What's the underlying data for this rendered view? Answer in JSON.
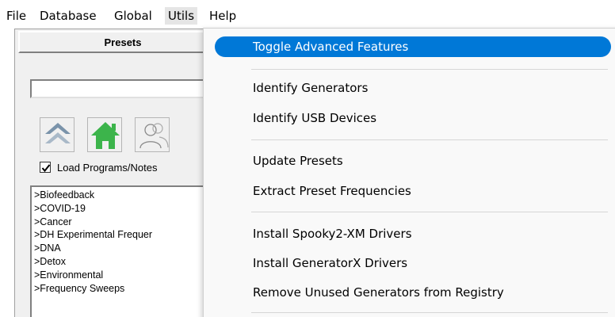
{
  "menubar": {
    "items": [
      {
        "label": "File"
      },
      {
        "label": "Database"
      },
      {
        "label": "Global"
      },
      {
        "label": "Utils",
        "active": true
      },
      {
        "label": "Help"
      }
    ]
  },
  "presets_panel": {
    "title": "Presets",
    "search": {
      "value": "",
      "placeholder": ""
    },
    "toolbar": {
      "buttons": [
        {
          "icon": "double-chevron-up-icon"
        },
        {
          "icon": "home-icon"
        },
        {
          "icon": "users-icon"
        }
      ]
    },
    "load_checkbox": {
      "label": "Load Programs/Notes",
      "checked": true
    },
    "list": [
      ">Biofeedback",
      ">COVID-19",
      ">Cancer",
      ">DH Experimental Frequer",
      ">DNA",
      ">Detox",
      ">Environmental",
      ">Frequency Sweeps"
    ]
  },
  "utils_menu": {
    "highlighted_index": 0,
    "highlight_color": "#0078d7",
    "groups": [
      [
        "Toggle Advanced Features"
      ],
      [
        "Identify Generators",
        "Identify USB Devices"
      ],
      [
        "Update Presets",
        "Extract Preset Frequencies"
      ],
      [
        "Install Spooky2-XM Drivers",
        "Install GeneratorX Drivers",
        "Remove Unused Generators from Registry"
      ]
    ]
  }
}
